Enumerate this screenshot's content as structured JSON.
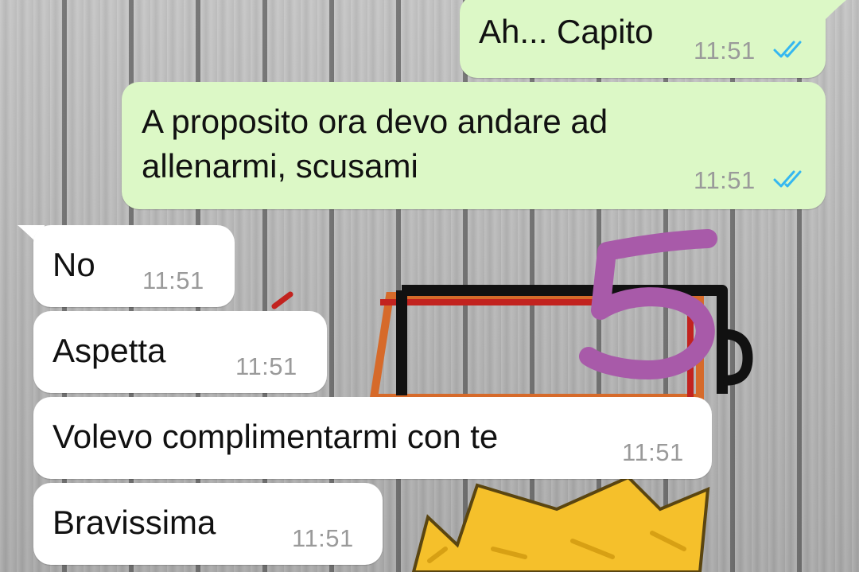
{
  "colors": {
    "outgoing_bubble": "#dcf8c6",
    "incoming_bubble": "#ffffff",
    "timestamp": "#9a9a9a",
    "read_ticks": "#34b7f1",
    "annotation_number": "#a85aa9"
  },
  "annotation": {
    "number": "5"
  },
  "messages": [
    {
      "direction": "outgoing",
      "text": "Ah... Capito",
      "time": "11:51",
      "status_icon": "double-check-read-icon"
    },
    {
      "direction": "outgoing",
      "text": "A proposito ora devo andare ad\nallenarmi, scusami",
      "time": "11:51",
      "status_icon": "double-check-read-icon"
    },
    {
      "direction": "incoming",
      "text": "No",
      "time": "11:51"
    },
    {
      "direction": "incoming",
      "text": "Aspetta",
      "time": "11:51"
    },
    {
      "direction": "incoming",
      "text": "Volevo complimentarmi con te",
      "time": "11:51"
    },
    {
      "direction": "incoming",
      "text": "Bravissima",
      "time": "11:51"
    }
  ]
}
